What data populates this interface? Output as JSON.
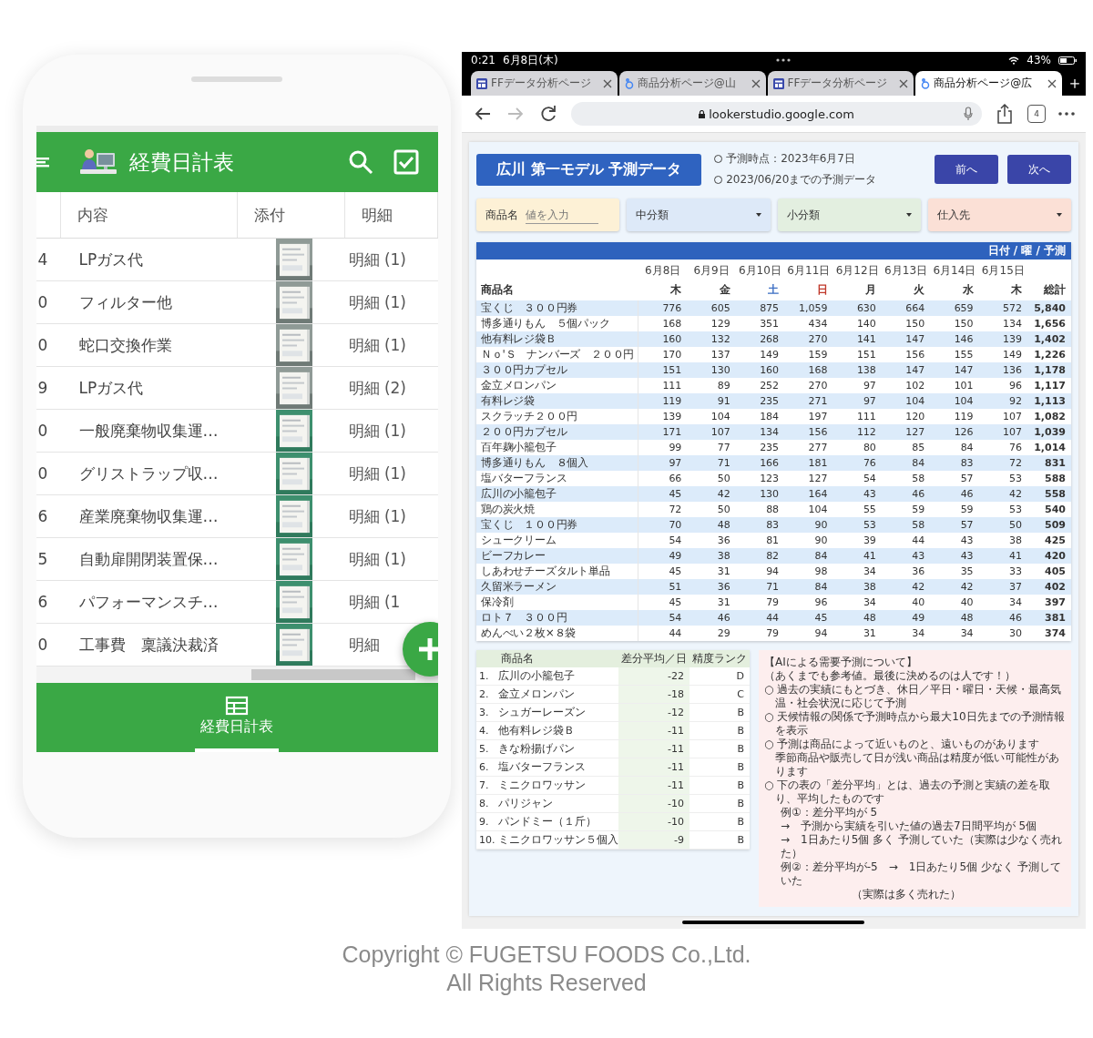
{
  "phone": {
    "header": {
      "title": "経費日計表"
    },
    "columns": [
      "内容",
      "添付",
      "明細"
    ],
    "rows": [
      {
        "column_1": "4",
        "content": "LPガス代",
        "detail": "明細 (1)"
      },
      {
        "column_1": "0",
        "content": "フィルター他",
        "detail": "明細 (1)"
      },
      {
        "column_1": "0",
        "content": "蛇口交換作業",
        "detail": "明細 (1)"
      },
      {
        "column_1": "9",
        "content": "LPガス代",
        "detail": "明細 (2)"
      },
      {
        "column_1": "0",
        "content": "一般廃棄物収集運…",
        "detail": "明細 (1)"
      },
      {
        "column_1": "0",
        "content": "グリストラップ収…",
        "detail": "明細 (1)"
      },
      {
        "column_1": "6",
        "content": "産業廃棄物収集運…",
        "detail": "明細 (1)"
      },
      {
        "column_1": "5",
        "content": "自動扉開閉装置保…",
        "detail": "明細 (1)"
      },
      {
        "column_1": "6",
        "content": "パフォーマンスチ…",
        "detail": "明細 (1"
      },
      {
        "column_1": "0",
        "content": "工事費　稟議決裁済",
        "detail": "明細"
      }
    ],
    "nav": [
      {
        "label": "経費日計表",
        "selected": true
      }
    ]
  },
  "tablet": {
    "status": {
      "time": "0:21",
      "date": "6月8日(木)",
      "battery": "43%"
    },
    "tabs": [
      {
        "title": "FFデータ分析ページ",
        "kind": "report",
        "selected": false
      },
      {
        "title": "商品分析ページ@山",
        "kind": "looker",
        "selected": false
      },
      {
        "title": "FFデータ分析ページ",
        "kind": "report",
        "selected": false
      },
      {
        "title": "商品分析ページ@広",
        "kind": "looker",
        "selected": true
      }
    ],
    "toolbar": {
      "back_disabled": false,
      "forward_disabled": true,
      "url": "lookerstudio.google.com",
      "tab_count": "4"
    },
    "report": {
      "title": "広川 第一モデル 予測データ",
      "info": [
        "予測時点：2023年6月7日",
        "2023/06/20までの予測データ"
      ],
      "buttons": [
        "前へ",
        "次へ"
      ],
      "filters": [
        {
          "kind": "input",
          "label": "商品名",
          "placeholder": "値を入力",
          "color": "#fdf1d6"
        },
        {
          "kind": "dropdown",
          "label": "中分類",
          "color": "#dde9f8"
        },
        {
          "kind": "dropdown",
          "label": "小分類",
          "color": "#e3efe0"
        },
        {
          "kind": "dropdown",
          "label": "仕入先",
          "color": "#fbe0d6"
        }
      ]
    },
    "forecast": {
      "band": "日付 / 曜 / 予測",
      "name_header": "商品名",
      "total_header": "総計",
      "days": [
        {
          "date": "6月8日",
          "weekday": "木",
          "color": "#333333"
        },
        {
          "date": "6月9日",
          "weekday": "金",
          "color": "#333333"
        },
        {
          "date": "6月10日",
          "weekday": "土",
          "color": "#3d6fc4"
        },
        {
          "date": "6月11日",
          "weekday": "日",
          "color": "#c0392b"
        },
        {
          "date": "6月12日",
          "weekday": "月",
          "color": "#333333"
        },
        {
          "date": "6月13日",
          "weekday": "火",
          "color": "#333333"
        },
        {
          "date": "6月14日",
          "weekday": "水",
          "color": "#333333"
        },
        {
          "date": "6月15日",
          "weekday": "木",
          "color": "#333333"
        }
      ],
      "rows": [
        {
          "name": "宝くじ　３００円券",
          "values": [
            "776",
            "605",
            "875",
            "1,059",
            "630",
            "664",
            "659",
            "572"
          ],
          "total": "5,840"
        },
        {
          "name": "博多通りもん　５個パック",
          "values": [
            "168",
            "129",
            "351",
            "434",
            "140",
            "150",
            "150",
            "134"
          ],
          "total": "1,656"
        },
        {
          "name": "他有料レジ袋Ｂ",
          "values": [
            "160",
            "132",
            "268",
            "270",
            "141",
            "147",
            "146",
            "139"
          ],
          "total": "1,402"
        },
        {
          "name": "Ｎｏ'Ｓ　ナンバーズ　２００円",
          "values": [
            "170",
            "137",
            "149",
            "159",
            "151",
            "156",
            "155",
            "149"
          ],
          "total": "1,226"
        },
        {
          "name": "３００円カプセル",
          "values": [
            "151",
            "130",
            "160",
            "168",
            "138",
            "147",
            "147",
            "136"
          ],
          "total": "1,178"
        },
        {
          "name": "金立メロンパン",
          "values": [
            "111",
            "89",
            "252",
            "270",
            "97",
            "102",
            "101",
            "96"
          ],
          "total": "1,117"
        },
        {
          "name": "有料レジ袋",
          "values": [
            "119",
            "91",
            "235",
            "271",
            "97",
            "104",
            "104",
            "92"
          ],
          "total": "1,113"
        },
        {
          "name": "スクラッチ２００円",
          "values": [
            "139",
            "104",
            "184",
            "197",
            "111",
            "120",
            "119",
            "107"
          ],
          "total": "1,082"
        },
        {
          "name": "２００円カプセル",
          "values": [
            "171",
            "107",
            "134",
            "156",
            "112",
            "127",
            "126",
            "107"
          ],
          "total": "1,039"
        },
        {
          "name": "百年麹小籠包子",
          "values": [
            "99",
            "77",
            "235",
            "277",
            "80",
            "85",
            "84",
            "76"
          ],
          "total": "1,014"
        },
        {
          "name": "博多通りもん　８個入",
          "values": [
            "97",
            "71",
            "166",
            "181",
            "76",
            "84",
            "83",
            "72"
          ],
          "total": "831"
        },
        {
          "name": "塩バターフランス",
          "values": [
            "66",
            "50",
            "123",
            "127",
            "54",
            "58",
            "57",
            "53"
          ],
          "total": "588"
        },
        {
          "name": "広川の小籠包子",
          "values": [
            "45",
            "42",
            "130",
            "164",
            "43",
            "46",
            "46",
            "42"
          ],
          "total": "558"
        },
        {
          "name": "鶏の炭火焼",
          "values": [
            "72",
            "50",
            "88",
            "104",
            "55",
            "59",
            "59",
            "53"
          ],
          "total": "540"
        },
        {
          "name": "宝くじ　１００円券",
          "values": [
            "70",
            "48",
            "83",
            "90",
            "53",
            "58",
            "57",
            "50"
          ],
          "total": "509"
        },
        {
          "name": "シュークリーム",
          "values": [
            "54",
            "36",
            "81",
            "90",
            "39",
            "44",
            "43",
            "38"
          ],
          "total": "425"
        },
        {
          "name": "ビーフカレー",
          "values": [
            "49",
            "38",
            "82",
            "84",
            "41",
            "43",
            "43",
            "41"
          ],
          "total": "420"
        },
        {
          "name": "しあわせチーズタルト単品",
          "values": [
            "45",
            "31",
            "94",
            "98",
            "34",
            "36",
            "35",
            "33"
          ],
          "total": "405"
        },
        {
          "name": "久留米ラーメン",
          "values": [
            "51",
            "36",
            "71",
            "84",
            "38",
            "42",
            "42",
            "37"
          ],
          "total": "402"
        },
        {
          "name": "保冷剤",
          "values": [
            "45",
            "31",
            "79",
            "96",
            "34",
            "40",
            "40",
            "34"
          ],
          "total": "397"
        },
        {
          "name": "ロト７　３００円",
          "values": [
            "54",
            "46",
            "44",
            "45",
            "48",
            "49",
            "48",
            "46"
          ],
          "total": "381"
        },
        {
          "name": "めんべい２枚×８袋",
          "values": [
            "44",
            "29",
            "79",
            "94",
            "31",
            "34",
            "34",
            "30"
          ],
          "total": "374"
        }
      ]
    },
    "ranking": {
      "columns": [
        "商品名",
        "差分平均／日",
        "精度ランク"
      ],
      "rows": [
        {
          "rank": "1.",
          "name": "広川の小籠包子",
          "diff": "-22",
          "grade": "D"
        },
        {
          "rank": "2.",
          "name": "金立メロンパン",
          "diff": "-18",
          "grade": "C"
        },
        {
          "rank": "3.",
          "name": "シュガーレーズン",
          "diff": "-12",
          "grade": "B"
        },
        {
          "rank": "4.",
          "name": "他有料レジ袋Ｂ",
          "diff": "-11",
          "grade": "B"
        },
        {
          "rank": "5.",
          "name": "きな粉揚げパン",
          "diff": "-11",
          "grade": "B"
        },
        {
          "rank": "6.",
          "name": "塩バターフランス",
          "diff": "-11",
          "grade": "B"
        },
        {
          "rank": "7.",
          "name": "ミニクロワッサン",
          "diff": "-11",
          "grade": "B"
        },
        {
          "rank": "8.",
          "name": "パリジャン",
          "diff": "-10",
          "grade": "B"
        },
        {
          "rank": "9.",
          "name": "パンドミー（１斤）",
          "diff": "-10",
          "grade": "B"
        },
        {
          "rank": "10.",
          "name": "ミニクロワッサン５個入",
          "diff": "-9",
          "grade": "B"
        }
      ]
    },
    "notes": [
      {
        "kind": "plain",
        "text": "【AIによる需要予測について】"
      },
      {
        "kind": "plain",
        "text": "（あくまでも参考値。最後に決めるのは人です！）"
      },
      {
        "kind": "bullet",
        "text": "○ 過去の実績にもとづき、休日／平日・曜日・天候・最高気温・社会状況に応じて予測"
      },
      {
        "kind": "bullet",
        "text": "○ 天候情報の関係で予測時点から最大10日先までの予測情報を表示"
      },
      {
        "kind": "bullet",
        "text": "○ 予測は商品によって近いものと、遠いものがあります"
      },
      {
        "kind": "indent",
        "text": "季節商品や販売して日が浅い商品は精度が低い可能性があります"
      },
      {
        "kind": "bullet",
        "text": "○ 下の表の「差分平均」とは、過去の予測と実績の差を取り、平均したものです"
      },
      {
        "kind": "example",
        "text": "例①：差分平均が 5"
      },
      {
        "kind": "example",
        "text": "→　予測から実績を引いた値の過去7日間平均が 5個"
      },
      {
        "kind": "example",
        "text": "→　1日あたり5個 多く 予測していた（実際は少なく売れた）"
      },
      {
        "kind": "example",
        "text": "例②：差分平均が-5　→　1日あたり5個 少なく 予測していた"
      },
      {
        "kind": "sub",
        "text": "（実際は多く売れた）"
      }
    ]
  },
  "footer": {
    "lines": [
      "Copyright © FUGETSU FOODS Co.,Ltd.",
      "All Rights Reserved"
    ]
  }
}
